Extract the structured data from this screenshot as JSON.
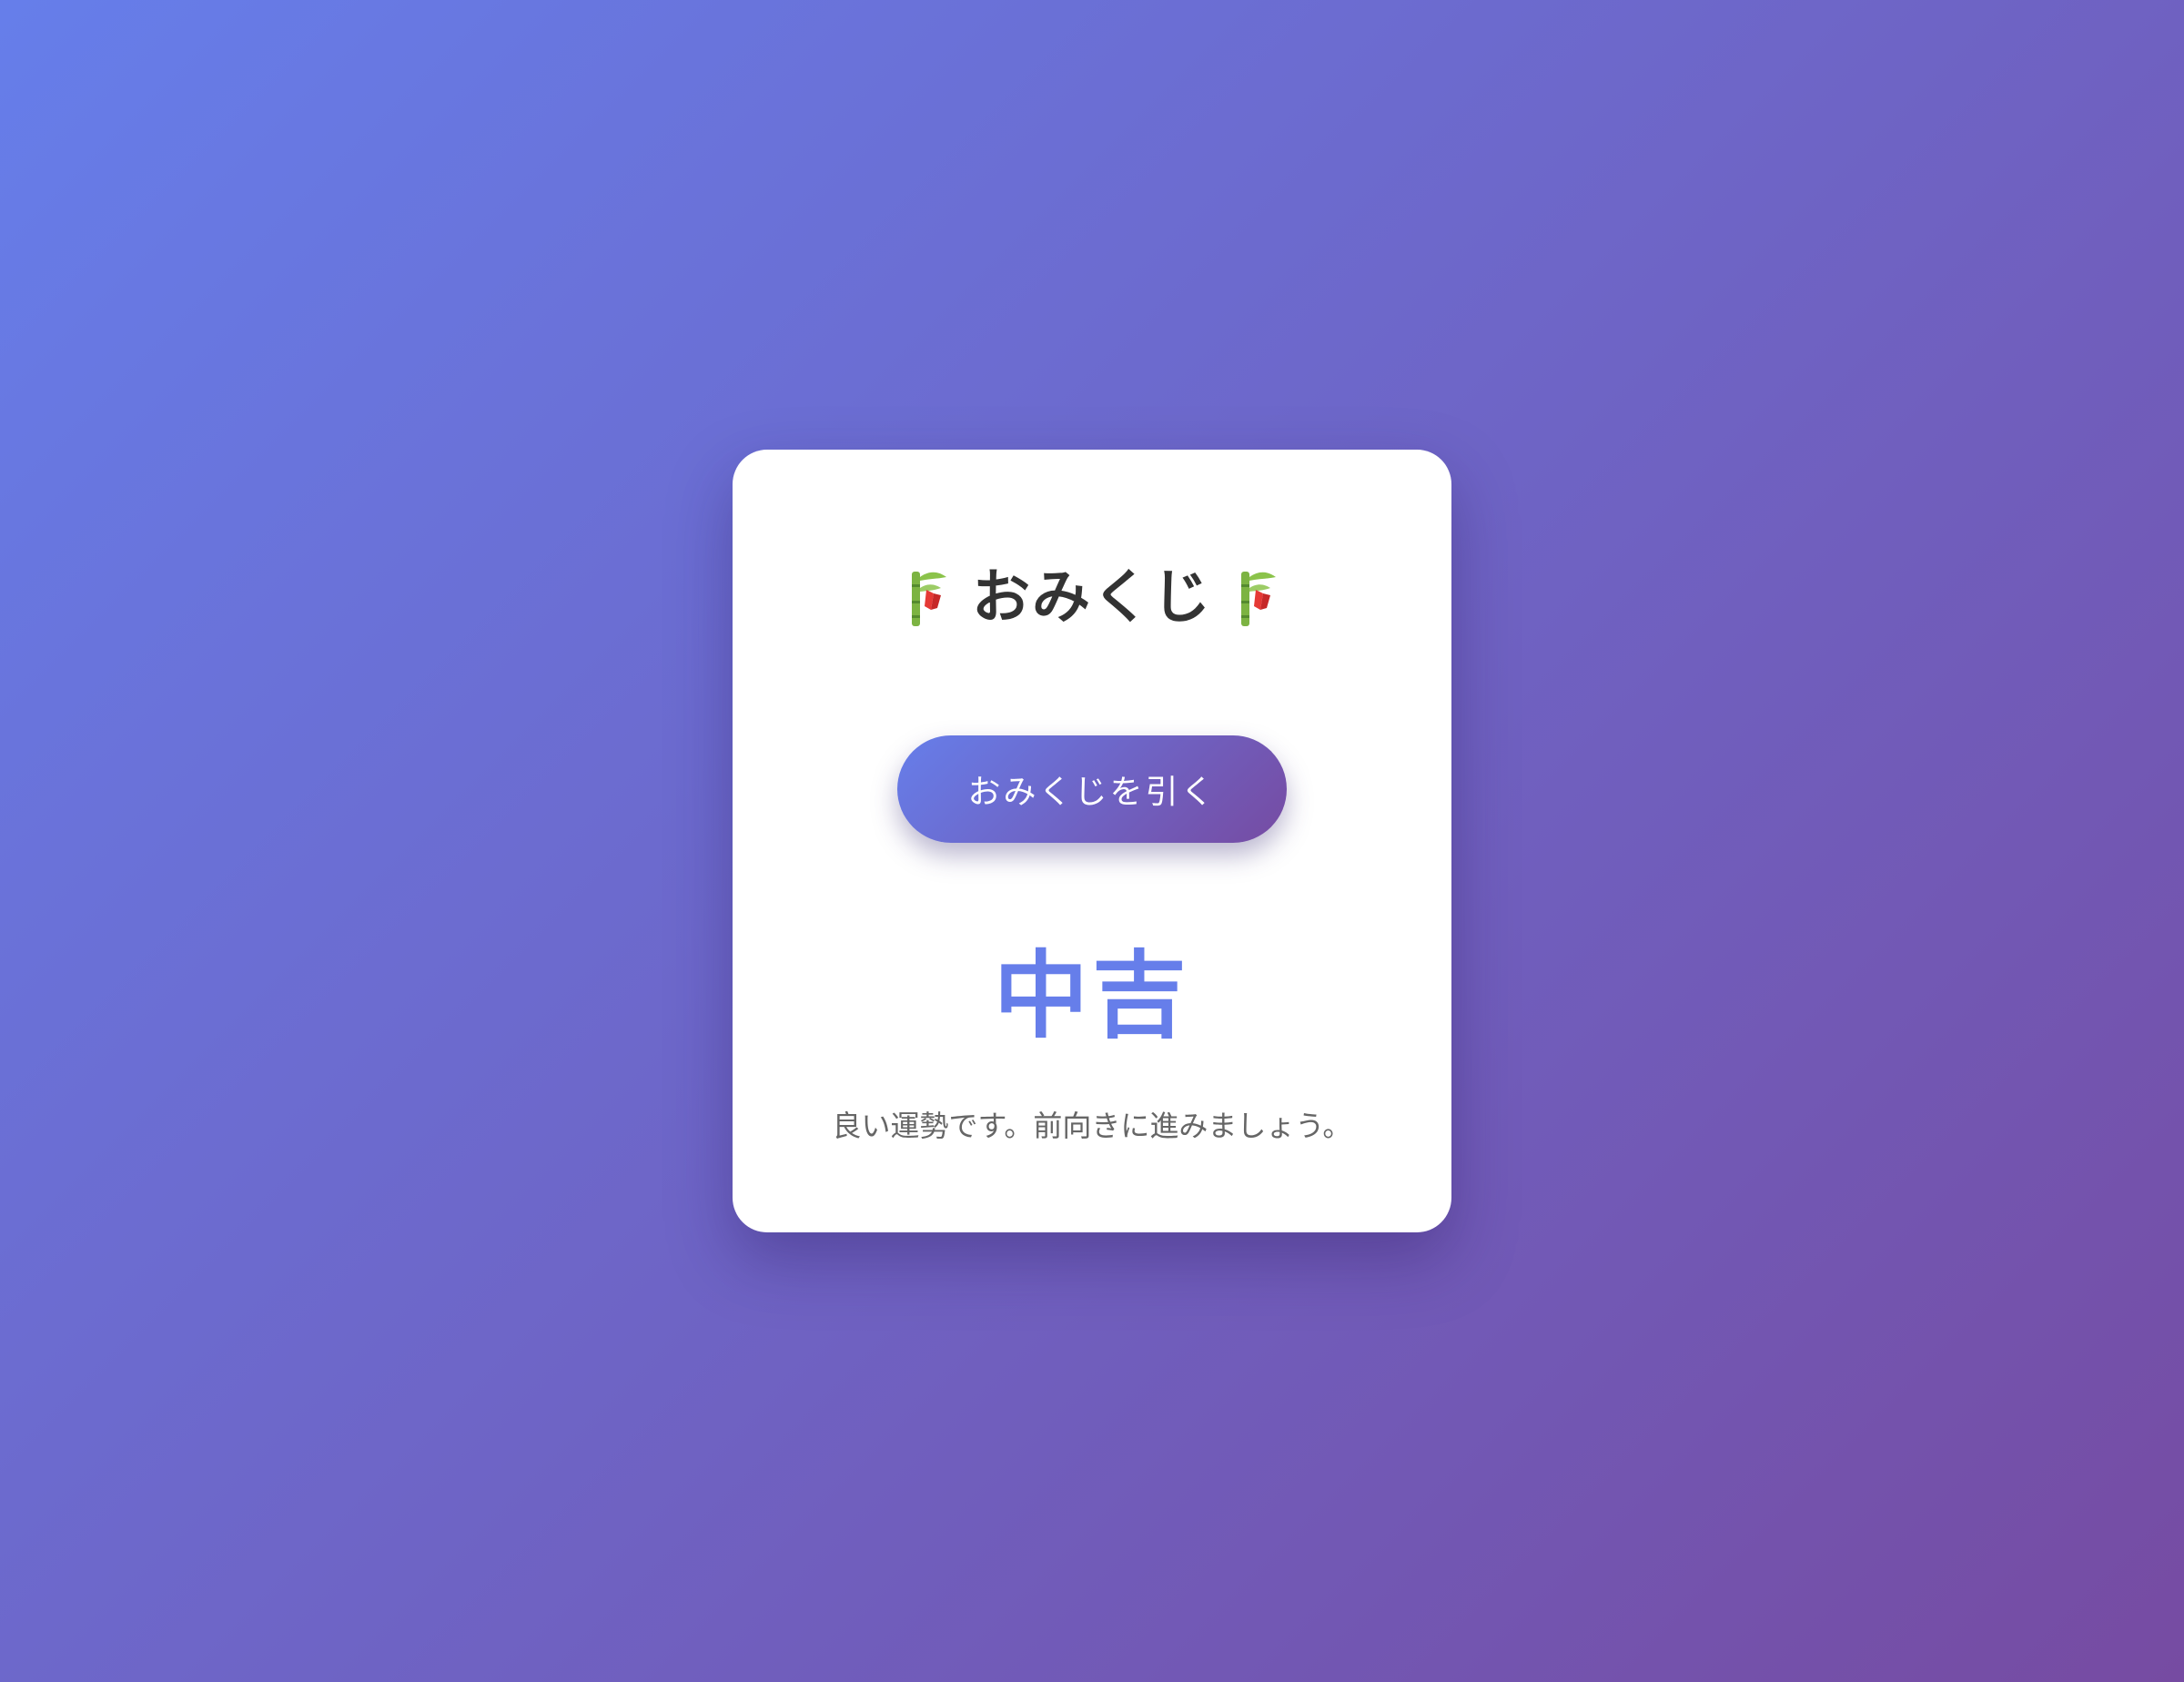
{
  "page": {
    "background_colors": [
      "#667eea",
      "#764ba2"
    ]
  },
  "omikuji": {
    "title": "おみくじ",
    "title_icon": "tanabata-tree-icon",
    "draw_button_label": "おみくじを引く",
    "result": "中吉",
    "message": "良い運勢です。前向きに進みましょう。",
    "accent_color": "#667eea",
    "title_color": "#333333",
    "message_color": "#666666"
  }
}
